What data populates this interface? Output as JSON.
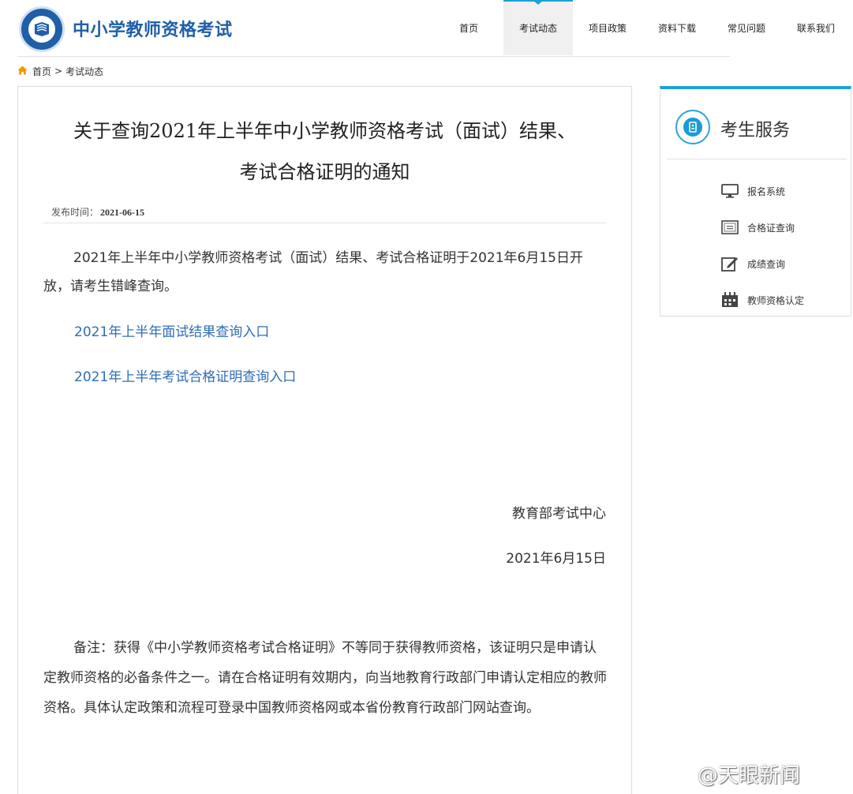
{
  "header": {
    "site_title": "中小学教师资格考试",
    "nav": [
      {
        "label": "首页"
      },
      {
        "label": "考试动态"
      },
      {
        "label": "项目政策"
      },
      {
        "label": "资料下载"
      },
      {
        "label": "常见问题"
      },
      {
        "label": "联系我们"
      }
    ],
    "active_nav": "考试动态"
  },
  "breadcrumb": {
    "home": "首页",
    "separator": ">",
    "current": "考试动态"
  },
  "article": {
    "title_line1": "关于查询2021年上半年中小学教师资格考试（面试）结果、",
    "title_line2": "考试合格证明的通知",
    "publish_label": "发布时间：",
    "publish_date": "2021-06-15",
    "paragraph1": "2021年上半年中小学教师资格考试（面试）结果、考试合格证明于2021年6月15日开放，请考生错峰查询。",
    "link1": "2021年上半年面试结果查询入口",
    "link2": "2021年上半年考试合格证明查询入口",
    "signature_org": "教育部考试中心",
    "signature_date": "2021年6月15日",
    "note": "备注：获得《中小学教师资格考试合格证明》不等同于获得教师资格，该证明只是申请认定教师资格的必备条件之一。请在合格证明有效期内，向当地教育行政部门申请认定相应的教师资格。具体认定政策和流程可登录中国教师资格网或本省份教育行政部门网站查询。"
  },
  "sidebar": {
    "title": "考生服务",
    "items": [
      {
        "label": "报名系统",
        "icon": "monitor-icon"
      },
      {
        "label": "合格证查询",
        "icon": "certificate-icon"
      },
      {
        "label": "成绩查询",
        "icon": "edit-icon"
      },
      {
        "label": "教师资格认定",
        "icon": "calendar-icon"
      }
    ]
  },
  "watermark": "@天眼新闻",
  "colors": {
    "brand_blue": "#1f5fa8",
    "accent_cyan": "#1ca3d8",
    "link_blue": "#2f6db5",
    "home_icon_orange": "#f39800"
  }
}
